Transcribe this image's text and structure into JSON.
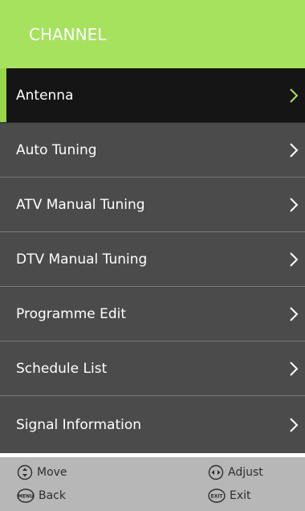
{
  "header": {
    "title": "CHANNEL"
  },
  "menu": {
    "selected_index": 0,
    "items": [
      {
        "label": "Antenna",
        "icon": "chevron-right-icon"
      },
      {
        "label": "Auto Tuning",
        "icon": "chevron-right-icon"
      },
      {
        "label": "ATV Manual Tuning",
        "icon": "chevron-right-icon"
      },
      {
        "label": "DTV Manual Tuning",
        "icon": "chevron-right-icon"
      },
      {
        "label": "Programme Edit",
        "icon": "chevron-right-icon"
      },
      {
        "label": "Schedule List",
        "icon": "chevron-right-icon"
      },
      {
        "label": "Signal Information",
        "icon": "chevron-right-icon"
      }
    ]
  },
  "footer": {
    "move": {
      "label": "Move",
      "icon": "up-down-arrows-icon"
    },
    "adjust": {
      "label": "Adjust",
      "icon": "left-right-arrows-icon"
    },
    "back": {
      "label": "Back",
      "icon": "menu-button-icon",
      "icon_text": "MENU"
    },
    "exit": {
      "label": "Exit",
      "icon": "exit-button-icon",
      "icon_text": "EXIT"
    }
  },
  "colors": {
    "header_bg": "#a6e25e",
    "item_bg": "#4b4b4b",
    "selected_bg": "#151515",
    "selected_accent": "#98d64a",
    "footer_bg": "#b7b7b7"
  }
}
